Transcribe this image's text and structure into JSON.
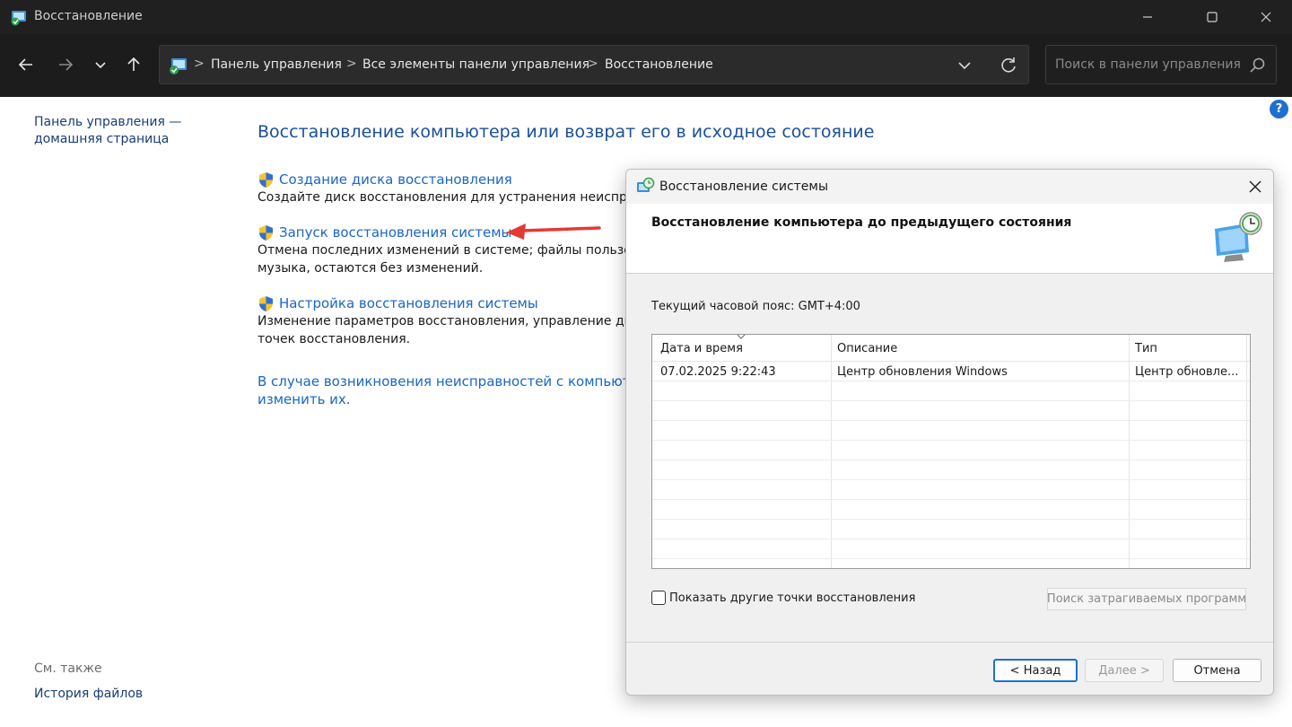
{
  "window": {
    "title": "Восстановление",
    "minimize_glyph": "—",
    "maximize_glyph": "☐",
    "close_glyph": "✕"
  },
  "address_bar": {
    "breadcrumbs": [
      "Панель управления",
      "Все элементы панели управления",
      "Восстановление"
    ],
    "separator": ">"
  },
  "search": {
    "placeholder": "Поиск в панели управления"
  },
  "sidebar": {
    "home_link": "Панель управления — домашняя страница",
    "see_also_label": "См. также",
    "file_history_link": "История файлов"
  },
  "main": {
    "title": "Восстановление компьютера или возврат его в исходное состояние",
    "items": [
      {
        "link": "Создание диска восстановления",
        "description": "Создайте диск восстановления для устранения неиспраВ"
      },
      {
        "link": "Запуск восстановления системы",
        "description": "Отмена последних изменений в системе; файлы пользова",
        "description2": "музыка, остаются без изменений."
      },
      {
        "link": "Настройка восстановления системы",
        "description": "Изменение параметров восстановления, управление диск",
        "description2": "точек восстановления."
      }
    ],
    "trouble_link_line1": "В случае возникновения неисправностей с компьютером",
    "trouble_link_line2": "изменить их."
  },
  "help_glyph": "?",
  "dialog": {
    "title": "Восстановление системы",
    "heading": "Восстановление компьютера до предыдущего состояния",
    "timezone": "Текущий часовой пояс: GMT+4:00",
    "columns": [
      "Дата и время",
      "Описание",
      "Тип"
    ],
    "rows": [
      {
        "date": "07.02.2025 9:22:43",
        "description": "Центр обновления Windows",
        "type": "Центр обновле..."
      }
    ],
    "show_more_label": "Показать другие точки восстановления",
    "show_more_checked": false,
    "scan_button": "Поиск затрагиваемых программ",
    "back_button": "< Назад",
    "next_button": "Далее >",
    "cancel_button": "Отмена"
  },
  "colors": {
    "accent_blue": "#1e6fd0",
    "link_blue": "#1a66c7",
    "title_blue": "#1a4f99",
    "arrow_red": "#e53935",
    "titlebar_dark": "#202020"
  }
}
